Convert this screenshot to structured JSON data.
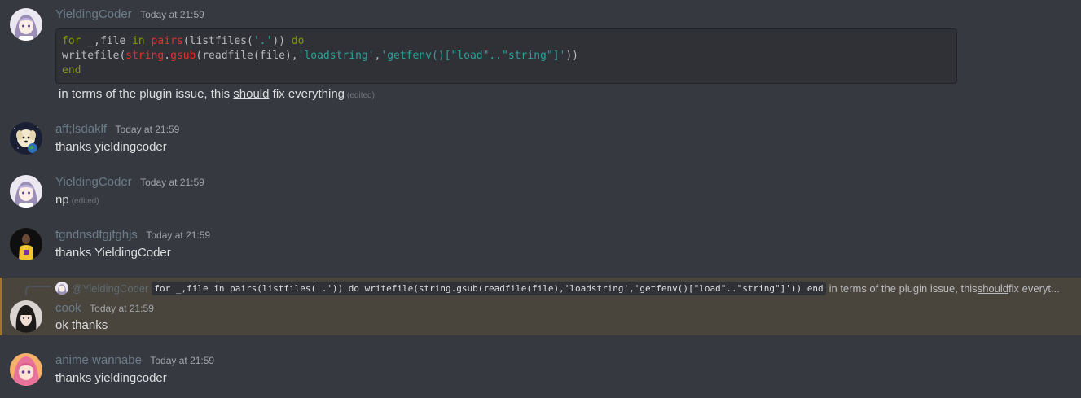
{
  "messages": [
    {
      "username": "YieldingCoder",
      "timestamp": "Today at 21:59",
      "code_lines": [
        [
          "for",
          " _,file ",
          "in",
          " ",
          "pairs",
          "(listfiles(",
          "'.'",
          ")) ",
          "do"
        ],
        [
          "writefile(",
          "string",
          ".",
          "gsub",
          "(readfile(file),",
          "'loadstring'",
          ",",
          "'getfenv()[\"load\"..\"string\"]'",
          "))"
        ],
        [
          "end"
        ]
      ],
      "text_before": "in terms of the plugin issue, this ",
      "text_underlined": "should",
      "text_after": " fix everything",
      "edited": "(edited)"
    },
    {
      "username": "aff;lsdaklf",
      "timestamp": "Today at 21:59",
      "text": "thanks yieldingcoder"
    },
    {
      "username": "YieldingCoder",
      "timestamp": "Today at 21:59",
      "text": "np",
      "edited": "(edited)"
    },
    {
      "username": "fgndnsdfgjfghjs",
      "timestamp": "Today at 21:59",
      "text": "thanks YieldingCoder"
    },
    {
      "username": "cook",
      "timestamp": "Today at 21:59",
      "text": "ok thanks",
      "reply": {
        "username": "@YieldingCoder",
        "code": "for _,file in pairs(listfiles('.')) do writefile(string.gsub(readfile(file),'loadstring','getfenv()[\"load\"..\"string\"]')) end",
        "text_before": "in terms of the plugin issue, this ",
        "text_underlined": "should",
        "text_after": " fix everyt..."
      }
    },
    {
      "username": "anime wannabe",
      "timestamp": "Today at 21:59",
      "text": "thanks yieldingcoder"
    }
  ],
  "colors": {
    "background": "#36393f",
    "mention_highlight": "#49443c",
    "code_keyword": "#859900",
    "code_function": "#dc322f",
    "code_string": "#2aa198"
  },
  "icons": [
    "avatar-anime-girl",
    "avatar-dog-earth",
    "avatar-basketball-player",
    "avatar-dark-hair-girl",
    "avatar-anime-pink"
  ]
}
